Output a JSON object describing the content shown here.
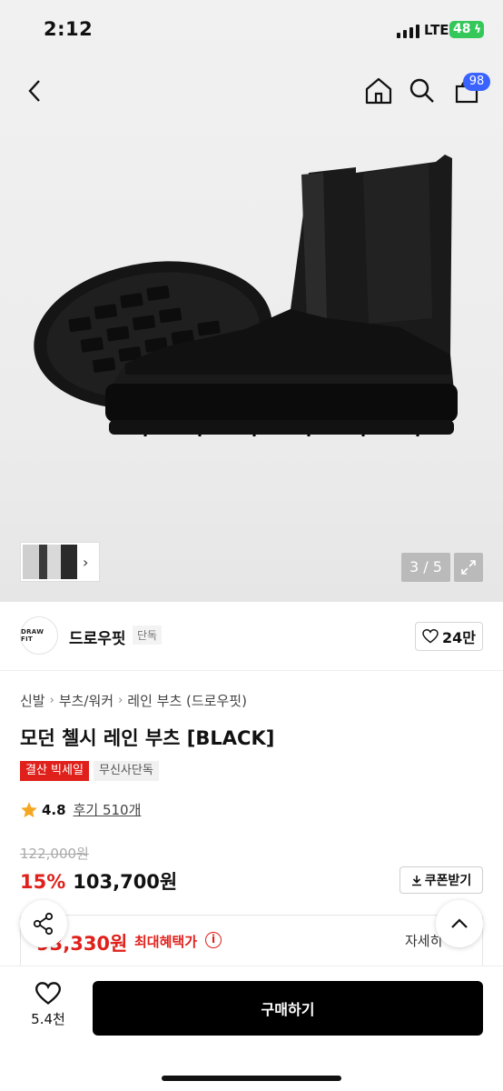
{
  "status_bar": {
    "time": "2:12",
    "network": "LTE",
    "battery": "48"
  },
  "top_nav": {
    "cart_count": "98"
  },
  "gallery": {
    "counter": "3 / 5"
  },
  "brand": {
    "logo_text": "DRAW FIT",
    "name": "드로우핏",
    "exclusive": "단독",
    "likes": "24만"
  },
  "breadcrumb": [
    "신발",
    "부츠/워커",
    "레인 부츠 (드로우핏)"
  ],
  "product": {
    "title": "모던 첼시 레인 부츠 [BLACK]",
    "tags": {
      "sale": "결산 빅세일",
      "exclusive": "무신사단독"
    },
    "rating": "4.8",
    "reviews": "후기 510개",
    "original_price": "122,000원",
    "discount": "15%",
    "price": "103,700원",
    "coupon_label": "쿠폰받기",
    "max_benefit_price": "93,330원",
    "max_benefit_label": "최대혜택가",
    "detail_label": "자세히"
  },
  "bottom_bar": {
    "wish_count": "5.4천",
    "buy_label": "구매하기"
  },
  "colors": {
    "accent_red": "#e0201b",
    "badge_blue": "#3a62ff",
    "battery_green": "#34c759"
  }
}
